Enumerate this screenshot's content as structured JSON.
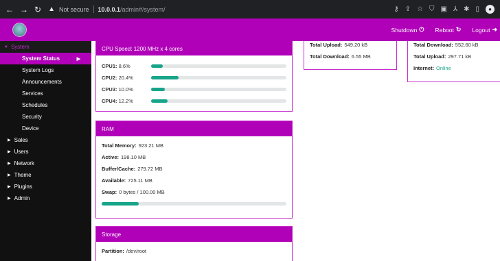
{
  "browser": {
    "not_secure": "Not secure",
    "url_host": "10.0.0.1",
    "url_path": "/admin#/system/"
  },
  "topbar": {
    "shutdown": "Shutdown",
    "reboot": "Reboot",
    "logout": "Logout"
  },
  "sidebar": {
    "group": "System",
    "items": [
      {
        "label": "System Status"
      },
      {
        "label": "System Logs"
      },
      {
        "label": "Announcements"
      },
      {
        "label": "Services"
      },
      {
        "label": "Schedules"
      },
      {
        "label": "Security"
      },
      {
        "label": "Device"
      }
    ],
    "categories": [
      {
        "label": "Sales"
      },
      {
        "label": "Users"
      },
      {
        "label": "Network"
      },
      {
        "label": "Theme"
      },
      {
        "label": "Plugins"
      },
      {
        "label": "Admin"
      }
    ]
  },
  "cpu": {
    "speed": "CPU Speed: 1200 MHz x 4 cores",
    "cores": [
      {
        "label": "CPU1:",
        "value": "8.6%",
        "pct": 8.6
      },
      {
        "label": "CPU2:",
        "value": "20.4%",
        "pct": 20.4
      },
      {
        "label": "CPU3:",
        "value": "10.0%",
        "pct": 10.0
      },
      {
        "label": "CPU4:",
        "value": "12.2%",
        "pct": 12.2
      }
    ]
  },
  "ram": {
    "title": "RAM",
    "total_label": "Total Memory:",
    "total_value": "923.21 MB",
    "active_label": "Active:",
    "active_value": "198.10 MB",
    "buffer_label": "Buffer/Cache:",
    "buffer_value": "279.72 MB",
    "available_label": "Available:",
    "available_value": "725.11 MB",
    "swap_label": "Swap:",
    "swap_value": "0 bytes / 100.00 MB",
    "swap_bar_pct": 20
  },
  "net1": {
    "upload_label": "Total Upload:",
    "upload_value": "549.20 kB",
    "download_label": "Total Download:",
    "download_value": "6.55 MB"
  },
  "net2": {
    "download_label": "Total Download:",
    "download_value": "552.60 kB",
    "upload_label": "Total Upload:",
    "upload_value": "297.71 kB",
    "internet_label": "Internet:",
    "internet_value": "Online"
  },
  "storage": {
    "title": "Storage",
    "partition_label": "Partition:",
    "partition_value": "/dev/root"
  }
}
